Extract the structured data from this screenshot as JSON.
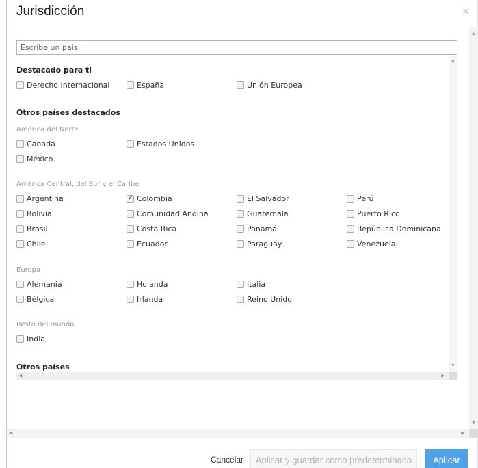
{
  "dialog": {
    "title": "Jurisdicción",
    "close_glyph": "×"
  },
  "search": {
    "placeholder": "Escribe un país",
    "value": ""
  },
  "featured": {
    "heading": "Destacado para ti",
    "items": [
      {
        "label": "Derecho Internacional",
        "checked": false
      },
      {
        "label": "España",
        "checked": false
      },
      {
        "label": "Unión Europea",
        "checked": false
      }
    ]
  },
  "others_featured": {
    "heading": "Otros países destacados",
    "regions": [
      {
        "name": "América del Norte",
        "items": [
          {
            "label": "Canada",
            "checked": false
          },
          {
            "label": "Estados Unidos",
            "checked": false
          },
          {
            "label": "México",
            "checked": false
          }
        ]
      },
      {
        "name": "América Central, del Sur y el Caribe",
        "items": [
          {
            "label": "Argentina",
            "checked": false
          },
          {
            "label": "Colombia",
            "checked": true
          },
          {
            "label": "El Salvador",
            "checked": false
          },
          {
            "label": "Perú",
            "checked": false
          },
          {
            "label": "Bolivia",
            "checked": false
          },
          {
            "label": "Comunidad Andina",
            "checked": false
          },
          {
            "label": "Guatemala",
            "checked": false
          },
          {
            "label": "Puerto Rico",
            "checked": false
          },
          {
            "label": "Brasil",
            "checked": false
          },
          {
            "label": "Costa Rica",
            "checked": false
          },
          {
            "label": "Panamá",
            "checked": false
          },
          {
            "label": "República Dominicana",
            "checked": false
          },
          {
            "label": "Chile",
            "checked": false
          },
          {
            "label": "Ecuador",
            "checked": false
          },
          {
            "label": "Paraguay",
            "checked": false
          },
          {
            "label": "Venezuela",
            "checked": false
          }
        ]
      },
      {
        "name": "Europa",
        "items": [
          {
            "label": "Alemania",
            "checked": false
          },
          {
            "label": "Holanda",
            "checked": false
          },
          {
            "label": "Italia",
            "checked": false
          },
          {
            "label": "Bélgica",
            "checked": false
          },
          {
            "label": "Irlanda",
            "checked": false
          },
          {
            "label": "Reino Unido",
            "checked": false
          }
        ]
      },
      {
        "name": "Resto del mundo",
        "items": [
          {
            "label": "India",
            "checked": false
          }
        ]
      }
    ]
  },
  "other_countries": {
    "heading": "Otros países"
  },
  "footer": {
    "cancel_label": "Cancelar",
    "save_default_label": "Aplicar y guardar como predeterminado",
    "apply_label": "Aplicar"
  },
  "colors": {
    "apply_button": "#4fa2e6",
    "disabled_text": "#b5b5b5"
  },
  "icons": {
    "checkbox": "checkbox-icon",
    "checked": "check-mark-icon"
  }
}
